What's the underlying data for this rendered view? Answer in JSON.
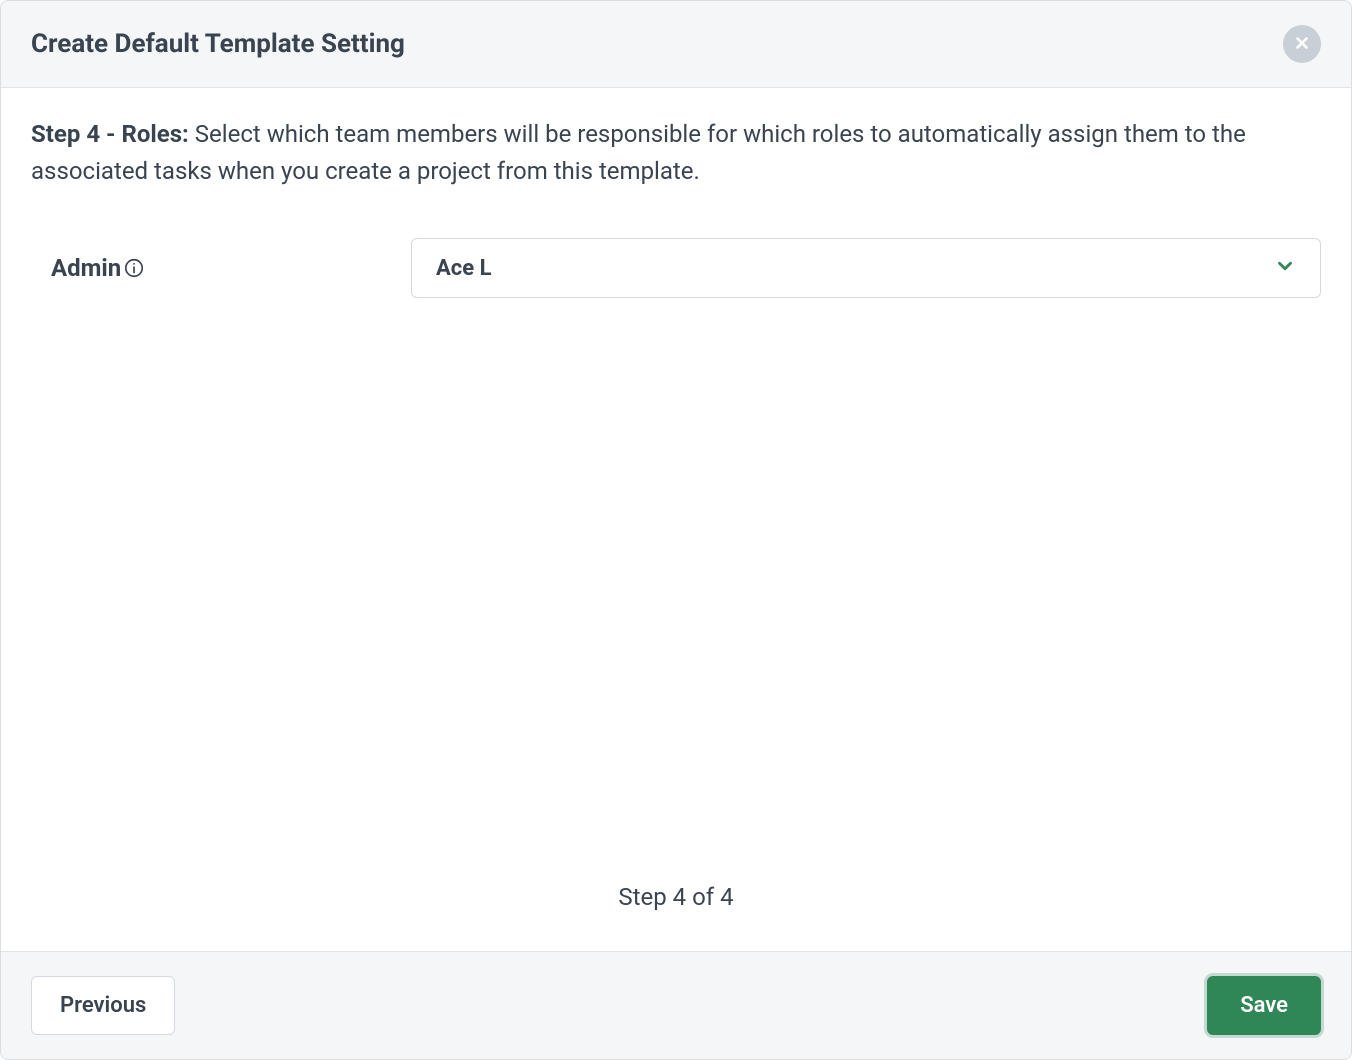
{
  "header": {
    "title": "Create Default Template Setting"
  },
  "body": {
    "step_prefix": "Step 4 - Roles: ",
    "step_description": "Select which team members will be responsible for which roles to automatically assign them to the associated tasks when you create a project from this template.",
    "role_label": "Admin",
    "dropdown_value": "Ace L",
    "step_indicator": "Step 4 of 4"
  },
  "footer": {
    "previous_label": "Previous",
    "save_label": "Save"
  }
}
